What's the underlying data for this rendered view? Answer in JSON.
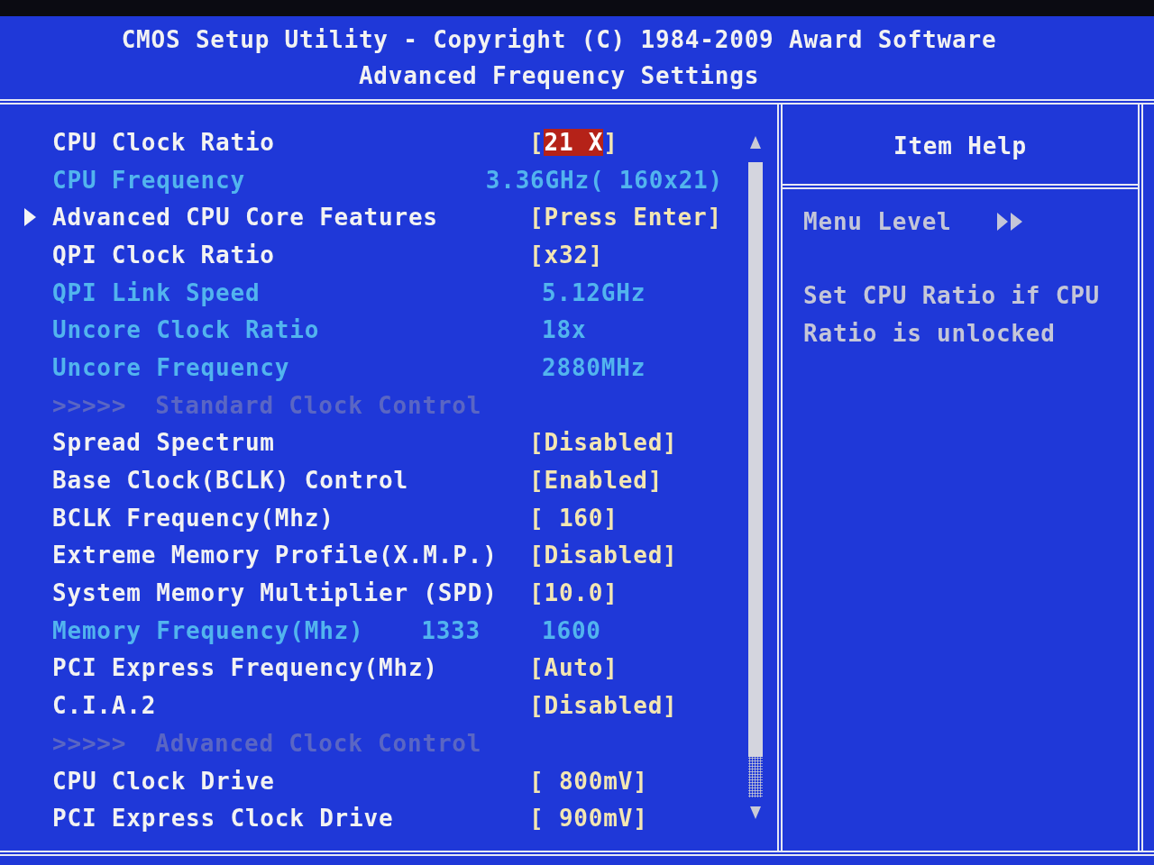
{
  "header": {
    "title": "CMOS Setup Utility - Copyright (C) 1984-2009 Award Software",
    "subtitle": "Advanced Frequency Settings"
  },
  "settings": [
    {
      "kind": "setting",
      "label": "CPU Clock Ratio",
      "value": "[21 X]",
      "selected": true
    },
    {
      "kind": "info",
      "label": "CPU Frequency",
      "value": "3.36GHz( 160x21)",
      "selected": false
    },
    {
      "kind": "submenu",
      "label": "Advanced CPU Core Features",
      "value": "[Press Enter]",
      "selected": false
    },
    {
      "kind": "setting",
      "label": "QPI Clock Ratio",
      "value": "[x32]",
      "selected": false
    },
    {
      "kind": "info",
      "label": "QPI Link Speed",
      "value": "5.12GHz",
      "selected": false
    },
    {
      "kind": "info",
      "label": "Uncore Clock Ratio",
      "value": "18x",
      "selected": false
    },
    {
      "kind": "info",
      "label": "Uncore Frequency",
      "value": "2880MHz",
      "selected": false
    },
    {
      "kind": "section",
      "marker": ">>>>>",
      "label": "Standard Clock Control",
      "selected": false
    },
    {
      "kind": "setting",
      "label": "Spread Spectrum",
      "value": "[Disabled]",
      "selected": false
    },
    {
      "kind": "setting",
      "label": "Base Clock(BCLK) Control",
      "value": "[Enabled]",
      "selected": false
    },
    {
      "kind": "setting",
      "label": "BCLK Frequency(Mhz)",
      "value": "[ 160]",
      "selected": false
    },
    {
      "kind": "setting",
      "label": "Extreme Memory Profile(X.M.P.)",
      "value": "[Disabled]",
      "selected": false
    },
    {
      "kind": "setting",
      "label": "System Memory Multiplier (SPD)",
      "value": "[10.0]",
      "selected": false
    },
    {
      "kind": "info",
      "label": "Memory Frequency(Mhz)",
      "note": "1333",
      "value": "1600",
      "selected": false
    },
    {
      "kind": "setting",
      "label": "PCI Express Frequency(Mhz)",
      "value": "[Auto]",
      "selected": false
    },
    {
      "kind": "setting",
      "label": "C.I.A.2",
      "value": "[Disabled]",
      "selected": false
    },
    {
      "kind": "section",
      "marker": ">>>>>",
      "label": "Advanced Clock Control",
      "selected": false
    },
    {
      "kind": "setting",
      "label": "CPU Clock Drive",
      "value": "[ 800mV]",
      "selected": false
    },
    {
      "kind": "setting",
      "label": "PCI Express Clock Drive",
      "value": "[ 900mV]",
      "selected": false
    }
  ],
  "help": {
    "title": "Item Help",
    "menu_level": "Menu Level",
    "text": "Set CPU Ratio if CPU Ratio is unlocked"
  }
}
